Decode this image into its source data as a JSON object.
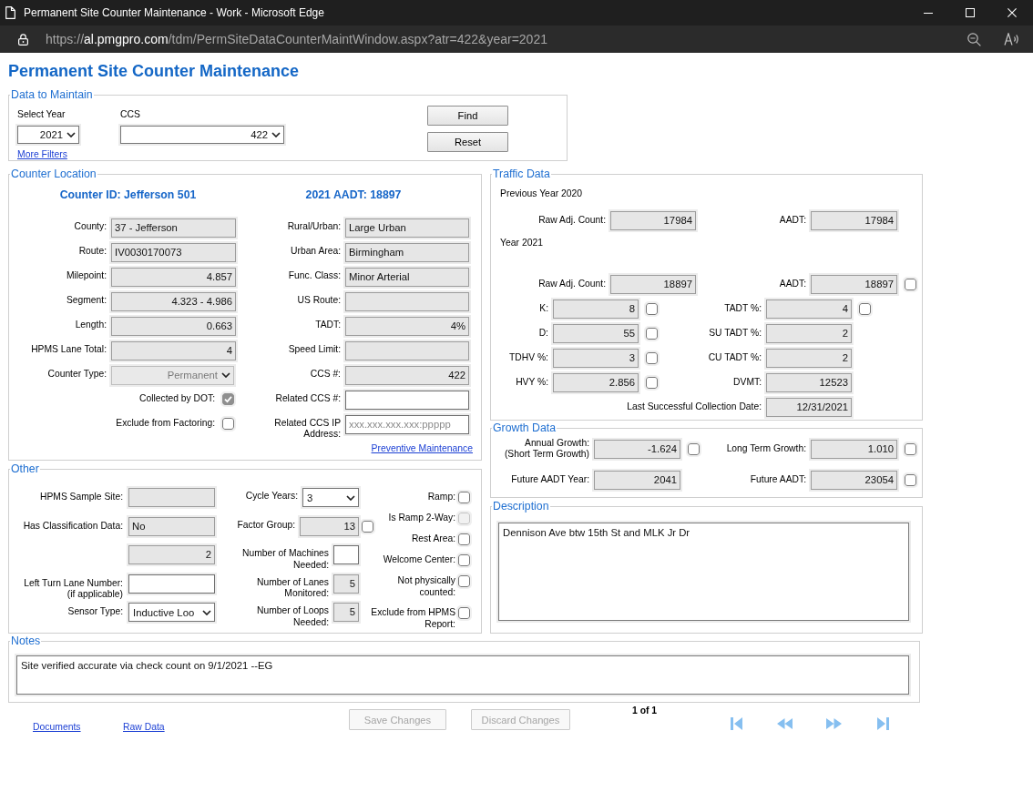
{
  "window": {
    "title": "Permanent Site Counter Maintenance - Work - Microsoft Edge",
    "url": {
      "scheme": "https://",
      "host": "al.pmgpro.com",
      "path": "/tdm/PermSiteDataCounterMaintWindow.aspx?atr=422&year=2021"
    }
  },
  "page_title": "Permanent Site Counter Maintenance",
  "data_to_maintain": {
    "legend": "Data to Maintain",
    "filters": [
      {
        "label": "Select Year",
        "value": "2021",
        "disabled": false
      },
      {
        "label": "CCS",
        "value": "422",
        "disabled": false
      }
    ],
    "link": "More Filters",
    "buttons": [
      {
        "label": "Find",
        "disabled": false
      },
      {
        "label": "Reset",
        "disabled": false
      }
    ]
  },
  "counter_location": {
    "legend": "Counter Location",
    "headings": [
      "Counter ID: Jefferson 501",
      "2021 AADT: 18897"
    ],
    "left_fields": [
      {
        "label": "County:",
        "kind": "text",
        "value": "37 - Jefferson",
        "readonly": true
      },
      {
        "label": "Route:",
        "kind": "text",
        "value": "IV0030170073",
        "readonly": true
      },
      {
        "label": "Milepoint:",
        "kind": "number",
        "value": "4.857",
        "readonly": true
      },
      {
        "label": "Segment:",
        "kind": "number",
        "value": "4.323 - 4.986",
        "readonly": true
      },
      {
        "label": "Length:",
        "kind": "number",
        "value": "0.663",
        "readonly": true
      },
      {
        "label": "HPMS Lane Total:",
        "kind": "number",
        "value": "4",
        "readonly": true
      },
      {
        "label": "Counter Type:",
        "kind": "select",
        "value": "Permanent",
        "disabled": true
      },
      {
        "label": "Collected by DOT:",
        "kind": "checkbox",
        "checked": true,
        "disabled": true
      },
      {
        "label": "Exclude from Factoring:",
        "kind": "checkbox",
        "checked": false,
        "disabled": false
      }
    ],
    "right_fields": [
      {
        "label": "Rural/Urban:",
        "kind": "text",
        "value": "Large Urban",
        "readonly": true
      },
      {
        "label": "Urban Area:",
        "kind": "text",
        "value": "Birmingham",
        "readonly": true
      },
      {
        "label": "Func. Class:",
        "kind": "text",
        "value": "Minor Arterial",
        "readonly": true
      },
      {
        "label": "US Route:",
        "kind": "text",
        "readonly": true
      },
      {
        "label": "TADT:",
        "kind": "number",
        "value": "4%",
        "readonly": true
      },
      {
        "label": "Speed Limit:",
        "kind": "text",
        "readonly": true
      },
      {
        "label": "CCS #:",
        "kind": "number",
        "value": "422",
        "readonly": true
      },
      {
        "label": "Related CCS #:",
        "kind": "text",
        "readonly": false
      },
      {
        "label": "Related CCS IP Address:",
        "kind": "text",
        "placeholder": "xxx.xxx.xxx.xxx:ppppp",
        "readonly": false
      }
    ],
    "link": "Preventive Maintenance"
  },
  "traffic_data": {
    "legend": "Traffic Data",
    "previous_year": {
      "heading": "Previous Year 2020",
      "fields": [
        {
          "label": "Raw Adj. Count:",
          "kind": "number",
          "value": "17984",
          "readonly": true
        },
        {
          "label": "AADT:",
          "kind": "number",
          "value": "17984",
          "readonly": true
        }
      ]
    },
    "current_year": {
      "heading": "Year 2021",
      "fields": [
        {
          "label": "Raw Adj. Count:",
          "kind": "number",
          "value": "18897",
          "readonly": true
        },
        {
          "label": "AADT:",
          "kind": "number",
          "value": "18897",
          "readonly": true,
          "checkbox": {
            "checked": false
          }
        }
      ],
      "left_fields": [
        {
          "label": "K:",
          "kind": "number",
          "value": "8",
          "readonly": true,
          "checkbox": {
            "checked": false
          }
        },
        {
          "label": "D:",
          "kind": "number",
          "value": "55",
          "readonly": true,
          "checkbox": {
            "checked": false
          }
        },
        {
          "label": "TDHV %:",
          "kind": "number",
          "value": "3",
          "readonly": true,
          "checkbox": {
            "checked": false
          }
        },
        {
          "label": "HVY %:",
          "kind": "number",
          "value": "2.856",
          "readonly": true,
          "checkbox": {
            "checked": false
          }
        }
      ],
      "right_fields": [
        {
          "label": "TADT %:",
          "kind": "number",
          "value": "4",
          "readonly": true,
          "checkbox": {
            "checked": false
          }
        },
        {
          "label": "SU TADT %:",
          "kind": "number",
          "value": "2",
          "readonly": true
        },
        {
          "label": "CU TADT %:",
          "kind": "number",
          "value": "2",
          "readonly": true
        },
        {
          "label": "DVMT:",
          "kind": "number",
          "value": "12523",
          "readonly": true
        },
        {
          "label": "Last Successful Collection Date:",
          "kind": "number",
          "value": "12/31/2021",
          "readonly": true
        }
      ]
    }
  },
  "growth_data": {
    "legend": "Growth Data",
    "left_fields": [
      {
        "label": "Annual Growth:",
        "note": "(Short Term Growth)",
        "kind": "number",
        "value": "-1.624",
        "readonly": true,
        "checkbox": {
          "checked": false
        }
      },
      {
        "label": "Future AADT Year:",
        "kind": "number",
        "value": "2041",
        "readonly": true
      }
    ],
    "right_fields": [
      {
        "label": "Long Term Growth:",
        "kind": "number",
        "value": "1.010",
        "readonly": true,
        "checkbox": {
          "checked": false
        }
      },
      {
        "label": "Future AADT:",
        "kind": "number",
        "value": "23054",
        "readonly": true,
        "checkbox": {
          "checked": false
        }
      }
    ]
  },
  "other": {
    "legend": "Other",
    "left_fields": [
      {
        "label": "HPMS Sample Site:",
        "kind": "text",
        "readonly": true
      },
      {
        "label": "Has Classification Data:",
        "kind": "text",
        "value": "No",
        "readonly": true
      },
      {
        "kind": "number",
        "value": "2",
        "readonly": true
      },
      {
        "label": "Left Turn Lane Number:",
        "note": "(if applicable)",
        "kind": "text",
        "readonly": false
      },
      {
        "label": "Sensor Type:",
        "kind": "select",
        "value": "Inductive Loo",
        "disabled": false
      }
    ],
    "middle_fields": [
      {
        "label": "Cycle Years:",
        "kind": "select",
        "value": "3",
        "disabled": false
      },
      {
        "label": "Factor Group:",
        "kind": "number",
        "value": "13",
        "readonly": true,
        "checkbox": {
          "checked": false
        }
      },
      {
        "label": "Number of Machines Needed:",
        "kind": "count",
        "readonly": false
      },
      {
        "label": "Number of Lanes Monitored:",
        "kind": "count",
        "value": "5",
        "readonly": true
      },
      {
        "label": "Number of Loops Needed:",
        "kind": "count",
        "value": "5",
        "readonly": true
      }
    ],
    "flags": [
      {
        "label": "Ramp:",
        "checked": false,
        "disabled": false
      },
      {
        "label": "Is Ramp 2-Way:",
        "checked": false,
        "disabled": true
      },
      {
        "label": "Rest Area:",
        "checked": false,
        "disabled": false
      },
      {
        "label": "Welcome Center:",
        "checked": false,
        "disabled": false
      },
      {
        "label": "Not physically counted:",
        "checked": false,
        "disabled": false
      },
      {
        "label": "Exclude from HPMS Report:",
        "checked": false,
        "disabled": false
      }
    ]
  },
  "description": {
    "legend": "Description",
    "value": "Dennison Ave btw 15th St and MLK Jr Dr"
  },
  "notes": {
    "legend": "Notes",
    "value": "Site verified accurate via check count on 9/1/2021 --EG"
  },
  "footer": {
    "links": [
      "Documents",
      "Raw Data"
    ],
    "buttons": [
      {
        "label": "Save Changes",
        "disabled": true
      },
      {
        "label": "Discard Changes",
        "disabled": true
      }
    ],
    "page_info": "1 of 1"
  }
}
